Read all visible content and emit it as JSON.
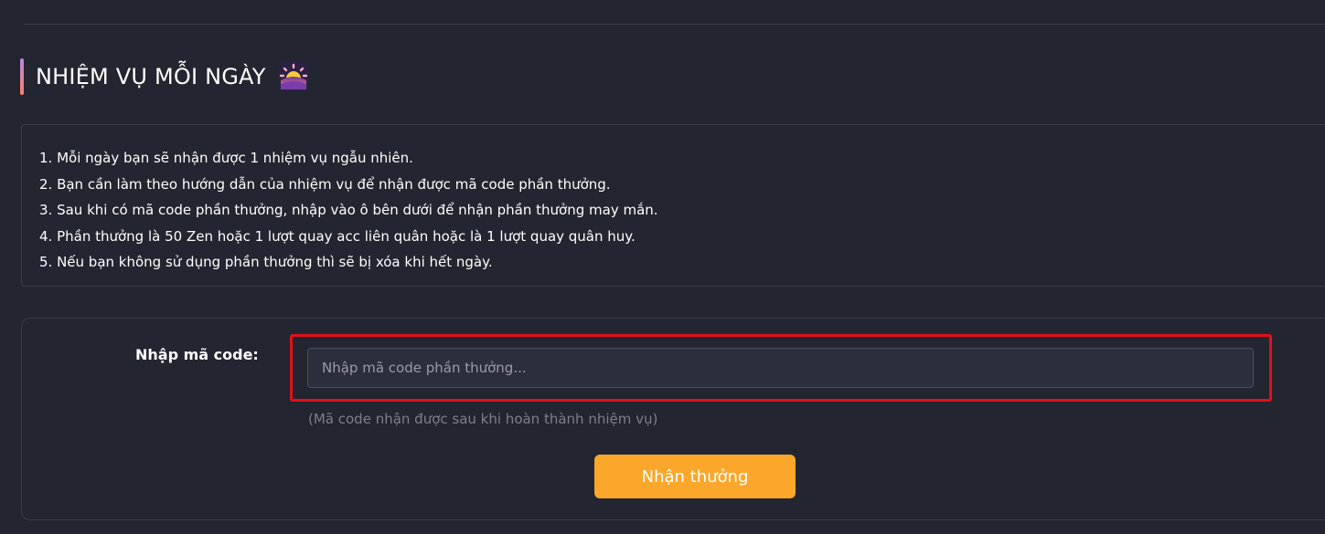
{
  "header": {
    "title": "NHIỆM VỤ MỖI NGÀY",
    "title_icon": "sunrise-emoji-icon",
    "accent_gradient": [
      "#b58ad8",
      "#ff7f6e"
    ]
  },
  "rules": [
    "1. Mỗi ngày bạn sẽ nhận được 1 nhiệm vụ ngẫu nhiên.",
    "2. Bạn cần làm theo hướng dẫn của nhiệm vụ để nhận được mã code phần thưởng.",
    "3. Sau khi có mã code phần thưởng, nhập vào ô bên dưới để nhận phần thưởng may mắn.",
    "4. Phần thưởng là 50 Zen hoặc 1 lượt quay acc liên quân hoặc là 1 lượt quay quân huy.",
    "5. Nếu bạn không sử dụng phần thưởng thì sẽ bị xóa khi hết ngày."
  ],
  "code_form": {
    "label": "Nhập mã code:",
    "input_value": "",
    "input_placeholder": "Nhập mã code phần thưởng...",
    "hint": "(Mã code nhận được sau khi hoàn thành nhiệm vụ)",
    "submit_label": "Nhận thưởng",
    "highlight_color": "#e0101a"
  },
  "colors": {
    "background": "#232530",
    "border": "#3a3d4a",
    "button": "#fba72b"
  }
}
